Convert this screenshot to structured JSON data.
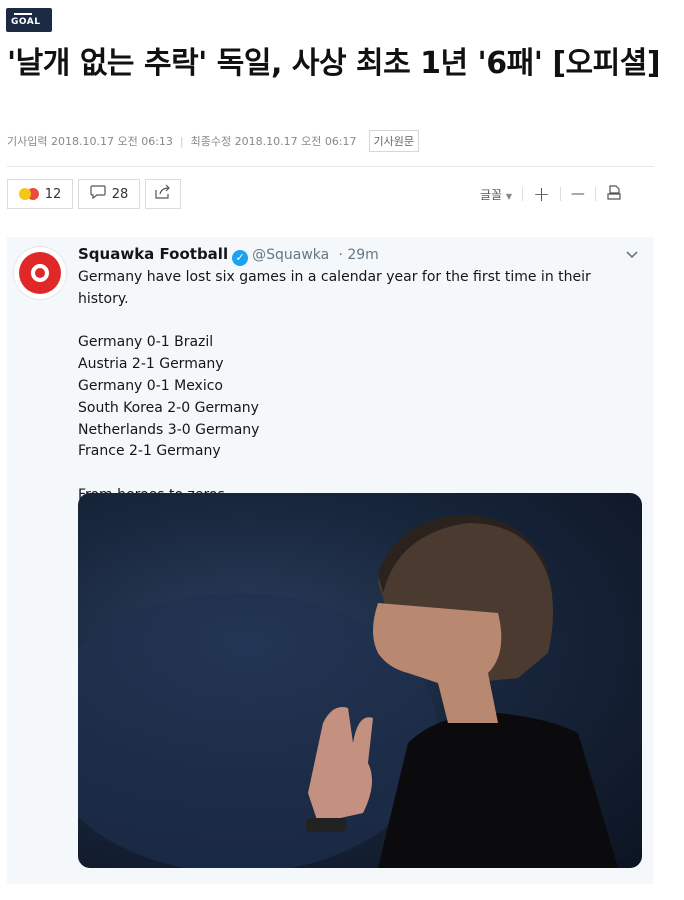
{
  "site": {
    "logo_text": "GOAL"
  },
  "article": {
    "title": "'날개 없는 추락' 독일, 사상 최초 1년 '6패' [오피셜]",
    "meta": {
      "published_label": "기사입력",
      "published": "2018.10.17 오전 06:13",
      "modified_label": "최종수정",
      "modified": "2018.10.17 오전 06:17",
      "original_label": "기사원문"
    }
  },
  "toolbar": {
    "reactions_count": "12",
    "comments_count": "28",
    "font_label": "글꼴",
    "increase_label": "+",
    "decrease_label": "—"
  },
  "tweet": {
    "author": "Squawka Football",
    "handle": "@Squawka",
    "time": "· 29m",
    "lines": [
      "Germany have lost six games in a calendar year for the first time in their history.",
      "",
      "Germany 0-1 Brazil",
      "Austria 2-1 Germany",
      "Germany 0-1 Mexico",
      "South Korea 2-0 Germany",
      "Netherlands 3-0 Germany",
      "France 2-1 Germany",
      "",
      "From heroes to zeros."
    ],
    "accent": "#1da1f2",
    "brand": "#e02828"
  },
  "icons": [
    "logo",
    "reaction-emoji-icon",
    "comment-icon",
    "share-icon",
    "chevron-down-icon",
    "print-icon",
    "verified-icon"
  ]
}
